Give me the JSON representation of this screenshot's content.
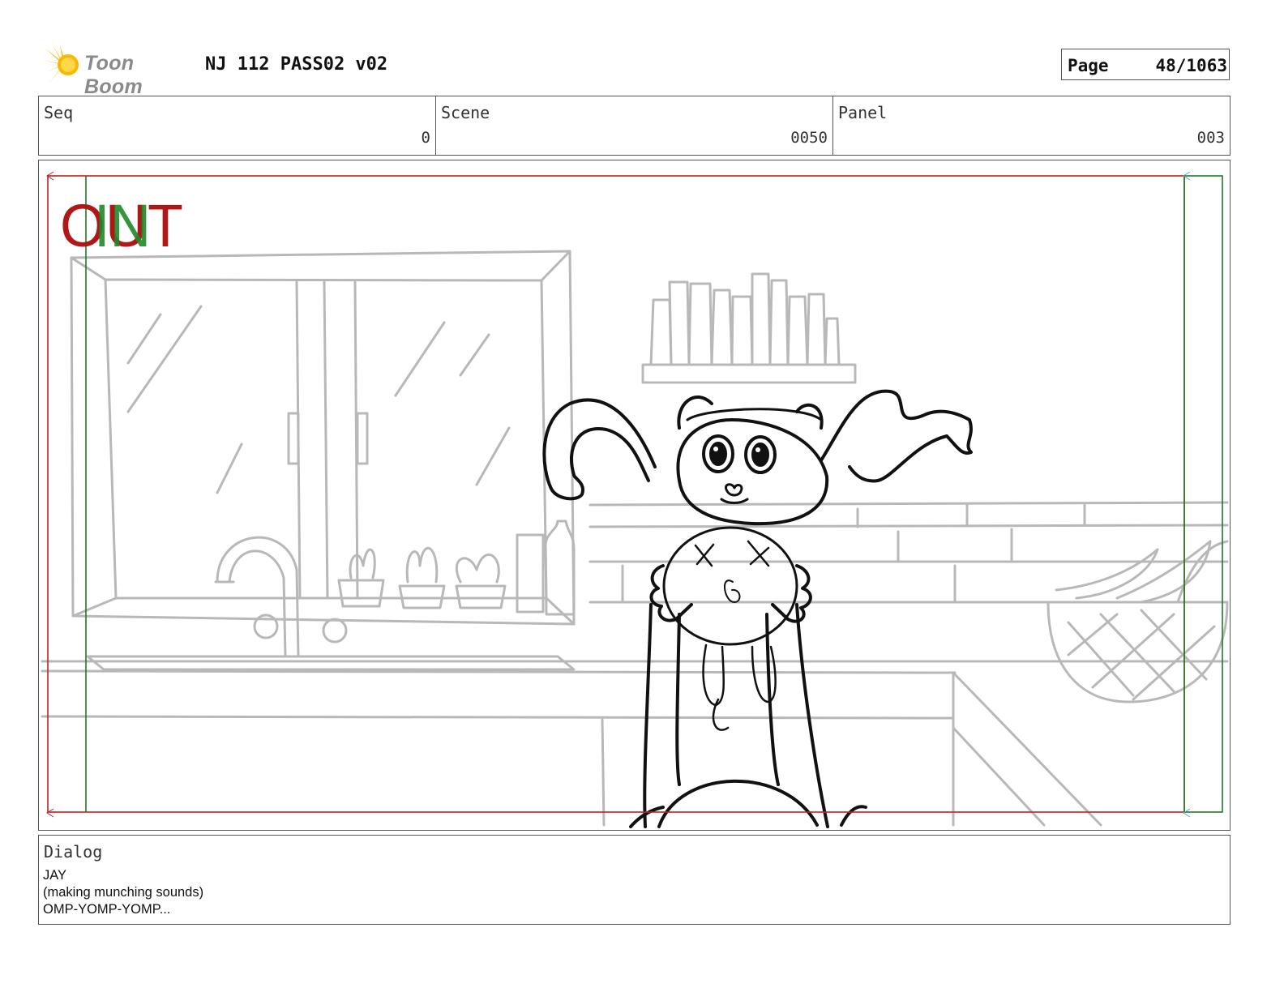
{
  "header": {
    "logo_text": "Toon Boom",
    "doc_title": "NJ 112 PASS02 v02",
    "page_label": "Page",
    "page_number": "48/1063"
  },
  "info": {
    "seq_label": "Seq",
    "seq_value": "0",
    "scene_label": "Scene",
    "scene_value": "0050",
    "panel_label": "Panel",
    "panel_value": "003"
  },
  "panel": {
    "transition_out": "OUT",
    "transition_in": "IN",
    "colors": {
      "out": "#b01818",
      "in": "#1e8a2a",
      "frame_red": "#c41e1e",
      "frame_green": "#1e7a2a",
      "background_sketch": "#b8b8b8",
      "character_line": "#111111"
    }
  },
  "dialog": {
    "label": "Dialog",
    "lines": [
      "JAY",
      "(making munching sounds)",
      "OMP-YOMP-YOMP..."
    ]
  }
}
